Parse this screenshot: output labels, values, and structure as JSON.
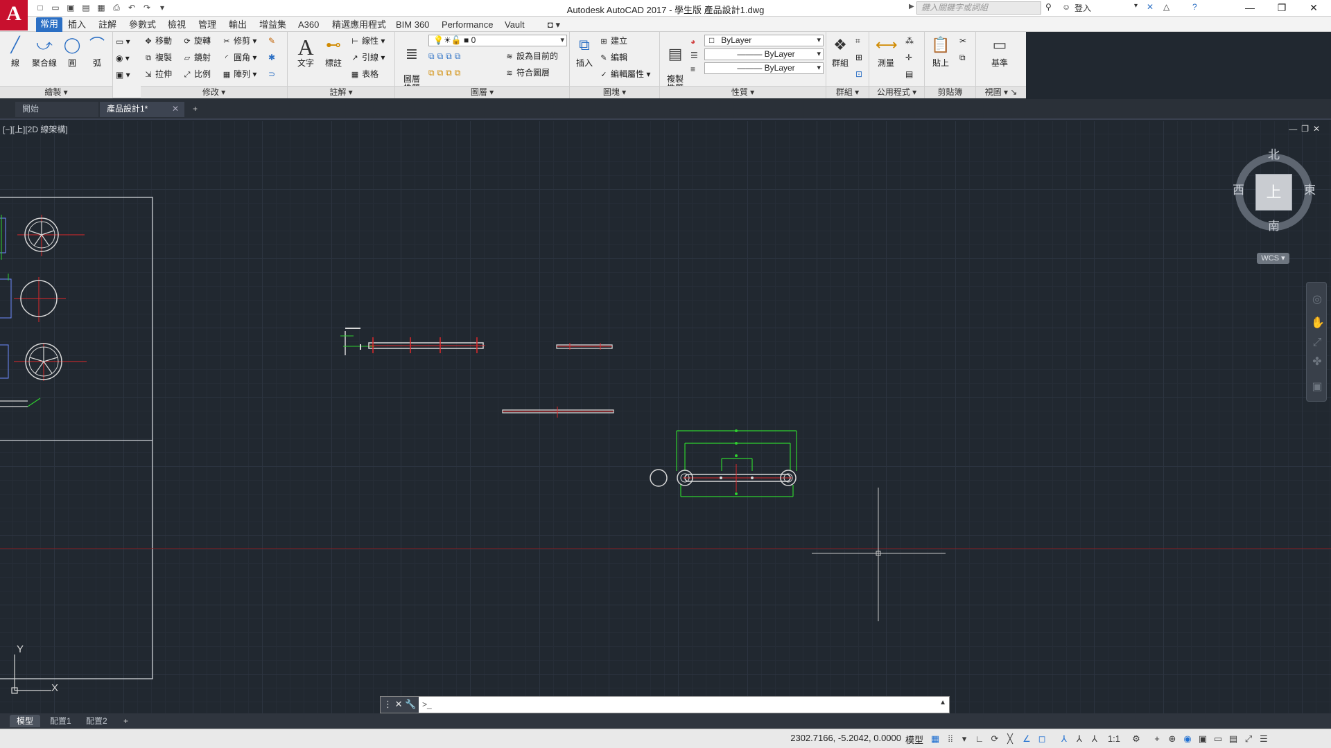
{
  "app": {
    "title": "Autodesk AutoCAD 2017 - 學生版    產品設計1.dwg",
    "logo_letter": "A",
    "search_placeholder": "鍵入關鍵字或詞組",
    "login_label": "登入"
  },
  "quick_access": [
    "new-icon",
    "open-icon",
    "save-icon",
    "saveas-icon",
    "print-icon",
    "undo-icon",
    "redo-icon"
  ],
  "ribbon_tabs": [
    "常用",
    "插入",
    "註解",
    "參數式",
    "檢視",
    "管理",
    "輸出",
    "增益集",
    "A360",
    "精選應用程式",
    "BIM 360",
    "Performance",
    "Vault"
  ],
  "active_ribbon_tab": "常用",
  "panels": {
    "draw": {
      "title": "繪製",
      "line": "線",
      "polyline": "聚合線",
      "circle": "圓",
      "arc": "弧"
    },
    "modify": {
      "title": "修改",
      "move": "移動",
      "rotate": "旋轉",
      "trim": "修剪",
      "copy": "複製",
      "mirror": "鏡射",
      "fillet": "圓角",
      "stretch": "拉伸",
      "scale": "比例",
      "array": "陣列"
    },
    "annotation": {
      "title": "註解",
      "text": "文字",
      "dimension": "標註",
      "linear": "線性",
      "leader": "引線",
      "table": "表格"
    },
    "layers": {
      "title": "圖層",
      "layer_properties": "圖層\n性質",
      "current_layer": "0",
      "set_current": "設為目前的",
      "match_layer": "符合圖層"
    },
    "block": {
      "title": "圖塊",
      "insert": "插入",
      "create": "建立",
      "edit": "編輯",
      "edit_attributes": "編輯屬性"
    },
    "properties": {
      "title": "性質",
      "match_properties": "複製\n性質",
      "color": "ByLayer",
      "linetype": "ByLayer",
      "lineweight": "ByLayer"
    },
    "groups": {
      "title": "群組",
      "group": "群組"
    },
    "utilities": {
      "title": "公用程式",
      "measure": "測量"
    },
    "clipboard": {
      "title": "剪貼簿",
      "paste": "貼上"
    },
    "view": {
      "title": "視圖",
      "base": "基準"
    }
  },
  "file_tabs": [
    {
      "label": "開始"
    },
    {
      "label": "產品設計1*"
    }
  ],
  "viewport": {
    "label": "[−][上][2D 線架構]",
    "viewcube": {
      "north": "北",
      "south": "南",
      "east": "東",
      "west": "西",
      "face": "上"
    },
    "wcs": "WCS",
    "ucs_x": "X",
    "ucs_y": "Y"
  },
  "command_line": {
    "value": "",
    "prompt_icon": ">_"
  },
  "layout_tabs": [
    "模型",
    "配置1",
    "配置2"
  ],
  "status": {
    "coordinates": "2302.7166, -5.2042, 0.0000",
    "model": "模型",
    "scale": "1:1"
  },
  "colors": {
    "canvas_bg": "#212830",
    "entity_white": "#d8d8d8",
    "entity_red": "#e0282a",
    "entity_green": "#2fd12f",
    "entity_blue": "#6f8bff",
    "accent": "#2b6fc4"
  }
}
